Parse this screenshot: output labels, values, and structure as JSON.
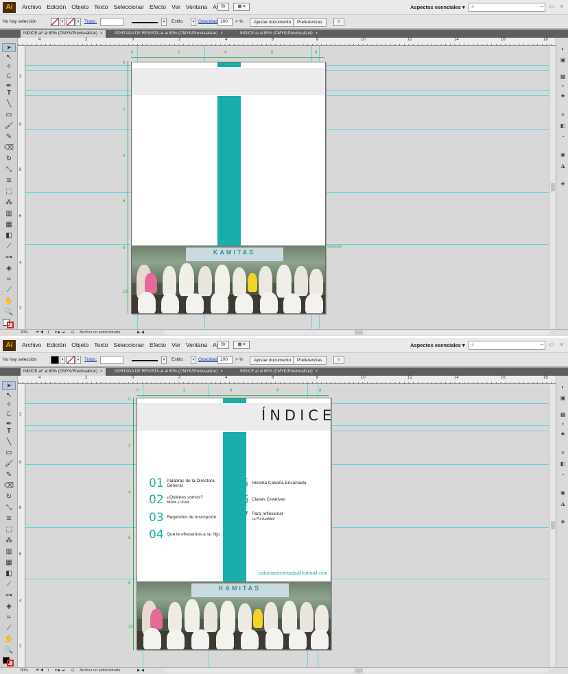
{
  "app": {
    "logo": "Ai",
    "menu": [
      "Archivo",
      "Edición",
      "Objeto",
      "Texto",
      "Seleccionar",
      "Efecto",
      "Ver",
      "Ventana",
      "Ayuda"
    ],
    "workspace": "Aspectos esenciales",
    "search_placeholder": "",
    "window_controls": "– ▭ ×"
  },
  "control": {
    "selection": "No hay selección",
    "stroke_label": "Trazo:",
    "style_label": "Estilo:",
    "opacity_label": "Opacidad:",
    "opacity_value": "100",
    "percent": "%",
    "fit_button": "Ajustar documento",
    "prefs_button": "Preferencias",
    "ai_icon_label": "Br",
    "grid_icon_label": "▦ ▾"
  },
  "tabs": [
    {
      "label": "INDICE.ai* al 80% (CMYK/Previsualizar)",
      "active": true
    },
    {
      "label": "PORTADA DE REVISTA.ai al 80% (CMYK/Previsualizar)",
      "active": false
    },
    {
      "label": "INDICE.ai al 80% (CMYK/Previsualizar)",
      "active": false
    }
  ],
  "ruler": {
    "top_labels": [
      "4",
      "2",
      "0",
      "2",
      "4",
      "6",
      "8",
      "10",
      "12",
      "14",
      "16",
      "18"
    ],
    "inner_labels": [
      "0",
      "2",
      "4",
      "6",
      "8"
    ],
    "left_labels": [
      "2",
      "0",
      "8",
      "6",
      "4",
      "2",
      "0"
    ],
    "artboard_left_labels": [
      "0",
      "2",
      "4",
      "6",
      "8",
      "10"
    ]
  },
  "document": {
    "title": "ÍNDICE",
    "entries_left": [
      {
        "num": "01",
        "title": "Palabras de la Directora",
        "title2": "General",
        "sub": ""
      },
      {
        "num": "02",
        "title": "¿Quiénes somos?",
        "title2": "",
        "sub": "Misión y Visión"
      },
      {
        "num": "03",
        "title": "Requisitos de Inscripción",
        "title2": "",
        "sub": ""
      },
      {
        "num": "04",
        "title": "Que le ofrecemos a su hijo",
        "title2": "",
        "sub": ""
      }
    ],
    "entries_right": [
      {
        "num": "05",
        "title": "Historia Cabaña Encantada",
        "title2": "",
        "sub": ""
      },
      {
        "num": "06",
        "title": "Clases Creativas",
        "title2": "",
        "sub": ""
      },
      {
        "num": "07",
        "title": "Para reflexionar",
        "title2": "",
        "sub": "La Puntualidad"
      }
    ],
    "email": "cabanaencantada@hotmail.com",
    "photo_banner": "KAMITAS",
    "bleed_label": "Sangrado"
  },
  "status": {
    "zoom": "80%",
    "page": "1",
    "message": "Archivo no administrado"
  },
  "colors": {
    "accent_teal": "#19aeaa",
    "guide_cyan": "#5fd3e2",
    "ai_brand": "#f7a81d"
  }
}
